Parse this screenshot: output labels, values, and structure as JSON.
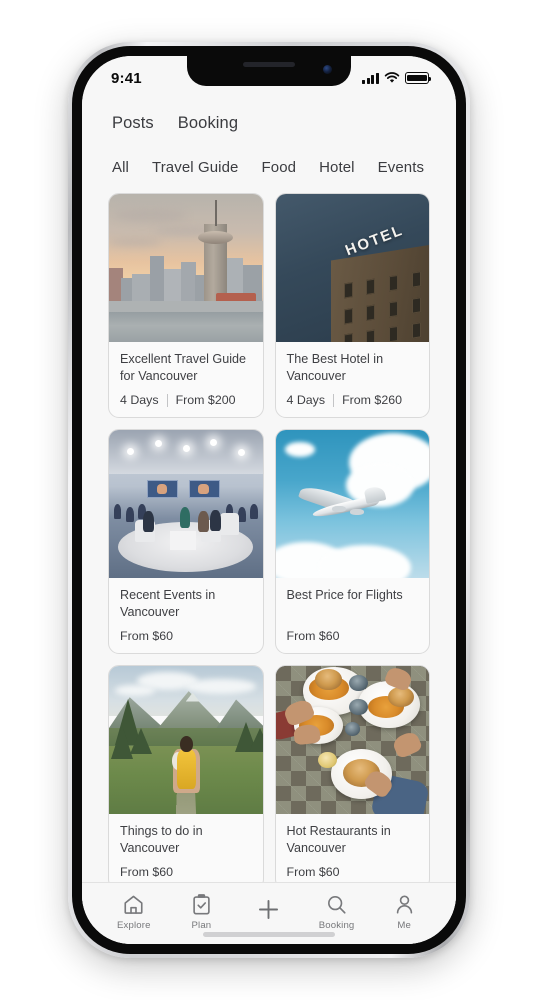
{
  "status_bar": {
    "time": "9:41",
    "icons": [
      "signal-icon",
      "wifi-icon",
      "battery-icon"
    ]
  },
  "header": {
    "tabs": [
      {
        "label": "Posts",
        "active": true
      },
      {
        "label": "Booking",
        "active": false
      }
    ]
  },
  "categories": [
    {
      "label": "All"
    },
    {
      "label": "Travel Guide"
    },
    {
      "label": "Food"
    },
    {
      "label": "Hotel"
    },
    {
      "label": "Events"
    }
  ],
  "cards": [
    {
      "title": "Excellent Travel Guide for Vancouver",
      "duration": "4 Days",
      "price": "From $200",
      "image": "vancouver-skyline-sunset"
    },
    {
      "title": "The Best Hotel in Vancouver",
      "duration": "4 Days",
      "price": "From $260",
      "image": "hotel-building-dusk"
    },
    {
      "title": "Recent Events in Vancouver",
      "duration": "",
      "price": "From $60",
      "image": "conference-panel-stage"
    },
    {
      "title": "Best Price for Flights",
      "duration": "",
      "price": "From $60",
      "image": "airplane-in-sky"
    },
    {
      "title": "Things to do in Vancouver",
      "duration": "",
      "price": "From $60",
      "image": "hiker-mountain-valley"
    },
    {
      "title": "Hot Restaurants in Vancouver",
      "duration": "",
      "price": "From $60",
      "image": "food-table-overhead"
    }
  ],
  "tabbar": [
    {
      "label": "Explore",
      "icon": "home-icon"
    },
    {
      "label": "Plan",
      "icon": "clipboard-check-icon"
    },
    {
      "label": "",
      "icon": "plus-icon"
    },
    {
      "label": "Booking",
      "icon": "search-icon"
    },
    {
      "label": "Me",
      "icon": "person-icon"
    }
  ],
  "colors": {
    "screen_bg": "#f7f7f7",
    "card_bg": "#fafafa",
    "card_border": "#dadada",
    "text_primary": "#3b3c40",
    "text_muted": "#77787b"
  }
}
